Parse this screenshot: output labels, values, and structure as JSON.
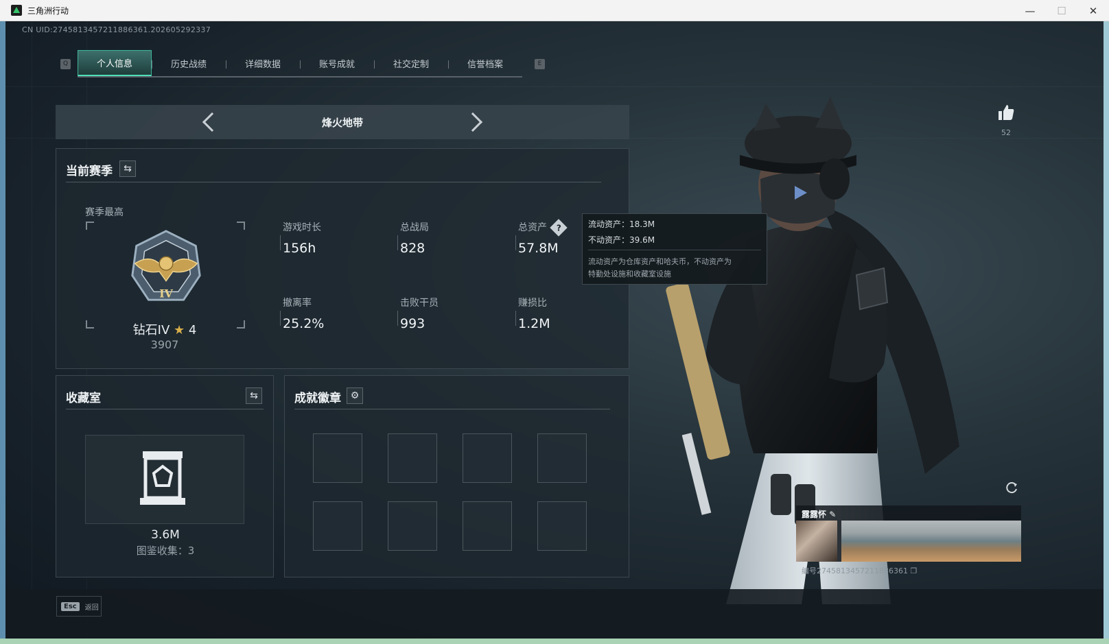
{
  "window": {
    "title": "三角洲行动"
  },
  "uid_text": "CN UID:2745813457211886361.202605292337",
  "tabs": {
    "left_key": "Q",
    "right_key": "E",
    "items": [
      {
        "label": "个人信息",
        "active": true
      },
      {
        "label": "历史战绩",
        "active": false
      },
      {
        "label": "详细数据",
        "active": false
      },
      {
        "label": "账号成就",
        "active": false
      },
      {
        "label": "社交定制",
        "active": false
      },
      {
        "label": "信誉档案",
        "active": false
      }
    ]
  },
  "mode": {
    "label": "烽火地带"
  },
  "season": {
    "title": "当前赛季",
    "best_label": "赛季最高",
    "rank_name": "钻石IV",
    "rank_star": "★",
    "rank_stars": "4",
    "rank_score": "3907",
    "stats": [
      {
        "label": "游戏时长",
        "value": "156h"
      },
      {
        "label": "总战局",
        "value": "828"
      },
      {
        "label": "总资产",
        "value": "57.8M",
        "help": "?"
      },
      {
        "label": "撤离率",
        "value": "25.2%"
      },
      {
        "label": "击败干员",
        "value": "993"
      },
      {
        "label": "赚损比",
        "value": "1.2M"
      }
    ]
  },
  "tooltip": {
    "liquid": "流动资产：18.3M",
    "fixed": "不动资产：39.6M",
    "desc_line1": "流动资产为仓库资产和哈夫币，不动资产为",
    "desc_line2": "特勤处设施和收藏室设施"
  },
  "collection": {
    "title": "收藏室",
    "value": "3.6M",
    "count": "图鉴收集：3"
  },
  "achievements": {
    "title": "成就徽章",
    "slot_count": 8
  },
  "likes": {
    "count": "52"
  },
  "namecard": {
    "title": "露露怀",
    "id_text": "编号2745813457211886361"
  },
  "bottom": {
    "esc_key": "Esc",
    "esc_label": "返回"
  },
  "colors": {
    "accent": "#4fe0b8",
    "gold": "#d9b04a",
    "panel_bg": "#1e282f"
  }
}
